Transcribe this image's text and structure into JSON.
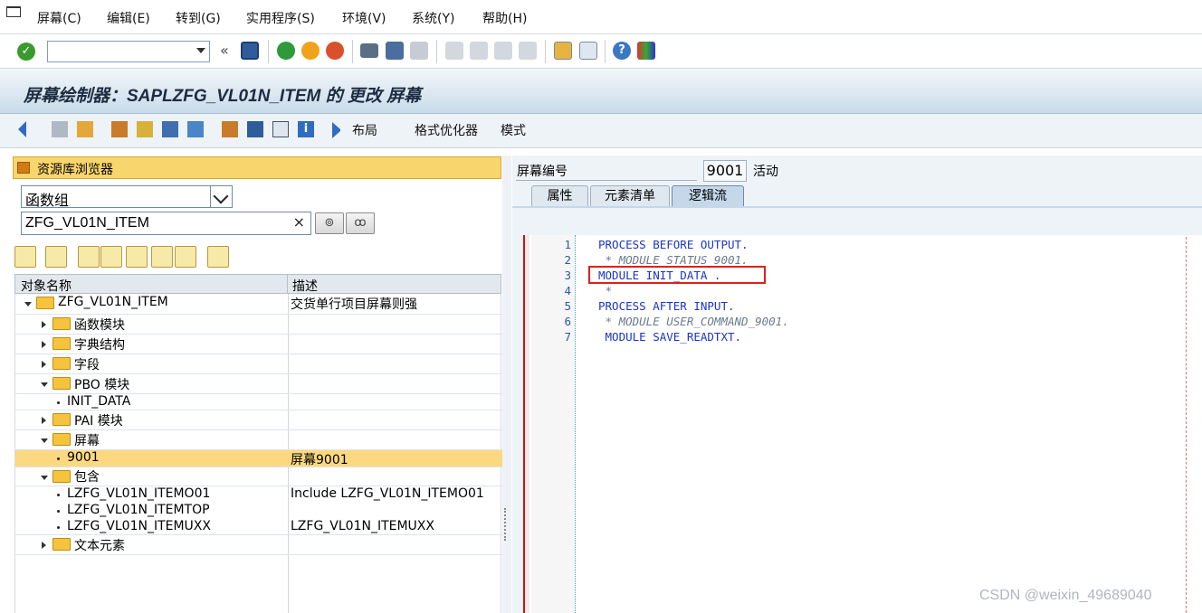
{
  "menu": {
    "items": [
      "屏幕(C)",
      "编辑(E)",
      "转到(G)",
      "实用程序(S)",
      "环境(V)",
      "系统(Y)",
      "帮助(H)"
    ]
  },
  "command_field": {
    "value": ""
  },
  "title": "屏幕绘制器：SAPLZFG_VL01N_ITEM 的 更改 屏幕",
  "app_toolbar": {
    "layout_label": "布局",
    "format_label": "格式优化器",
    "mode_label": "模式"
  },
  "repo_browser": {
    "title": "资源库浏览器",
    "object_type": "函数组",
    "object_name": "ZFG_VL01N_ITEM",
    "clear_label": "×",
    "col_name": "对象名称",
    "col_desc": "描述",
    "rows": [
      {
        "name": "ZFG_VL01N_ITEM",
        "desc": "交货单行项目屏幕则强"
      },
      {
        "name": "函数模块",
        "desc": ""
      },
      {
        "name": "字典结构",
        "desc": ""
      },
      {
        "name": "字段",
        "desc": ""
      },
      {
        "name": "PBO 模块",
        "desc": ""
      },
      {
        "name": "INIT_DATA",
        "desc": ""
      },
      {
        "name": "PAI 模块",
        "desc": ""
      },
      {
        "name": "屏幕",
        "desc": ""
      },
      {
        "name": "9001",
        "desc": "屏幕9001"
      },
      {
        "name": "包含",
        "desc": ""
      },
      {
        "name": "LZFG_VL01N_ITEMO01",
        "desc": "Include LZFG_VL01N_ITEMO01"
      },
      {
        "name": "LZFG_VL01N_ITEMTOP",
        "desc": ""
      },
      {
        "name": "LZFG_VL01N_ITEMUXX",
        "desc": "LZFG_VL01N_ITEMUXX"
      },
      {
        "name": "文本元素",
        "desc": ""
      }
    ]
  },
  "screen": {
    "label": "屏幕编号",
    "number": "9001",
    "status": "活动"
  },
  "tabs": [
    "属性",
    "元素清单",
    "逻辑流"
  ],
  "code_lines": [
    {
      "no": "1",
      "text": "PROCESS BEFORE OUTPUT.",
      "kind": "kw"
    },
    {
      "no": "2",
      "text": " * MODULE STATUS_9001.",
      "kind": "cm"
    },
    {
      "no": "3",
      "text": "MODULE INIT_DATA .",
      "kind": "kw"
    },
    {
      "no": "4",
      "text": " *",
      "kind": "cm"
    },
    {
      "no": "5",
      "text": "PROCESS AFTER INPUT.",
      "kind": "kw"
    },
    {
      "no": "6",
      "text": " * MODULE USER_COMMAND_9001.",
      "kind": "cm"
    },
    {
      "no": "7",
      "text": " MODULE SAVE_READTXT.",
      "kind": "kw"
    }
  ],
  "watermark": "CSDN @weixin_49689040",
  "colors": {
    "accent": "#f9d56d",
    "selected_row": "#fcd980",
    "keyword": "#1a35c7",
    "highlight_box": "#e0201b"
  }
}
